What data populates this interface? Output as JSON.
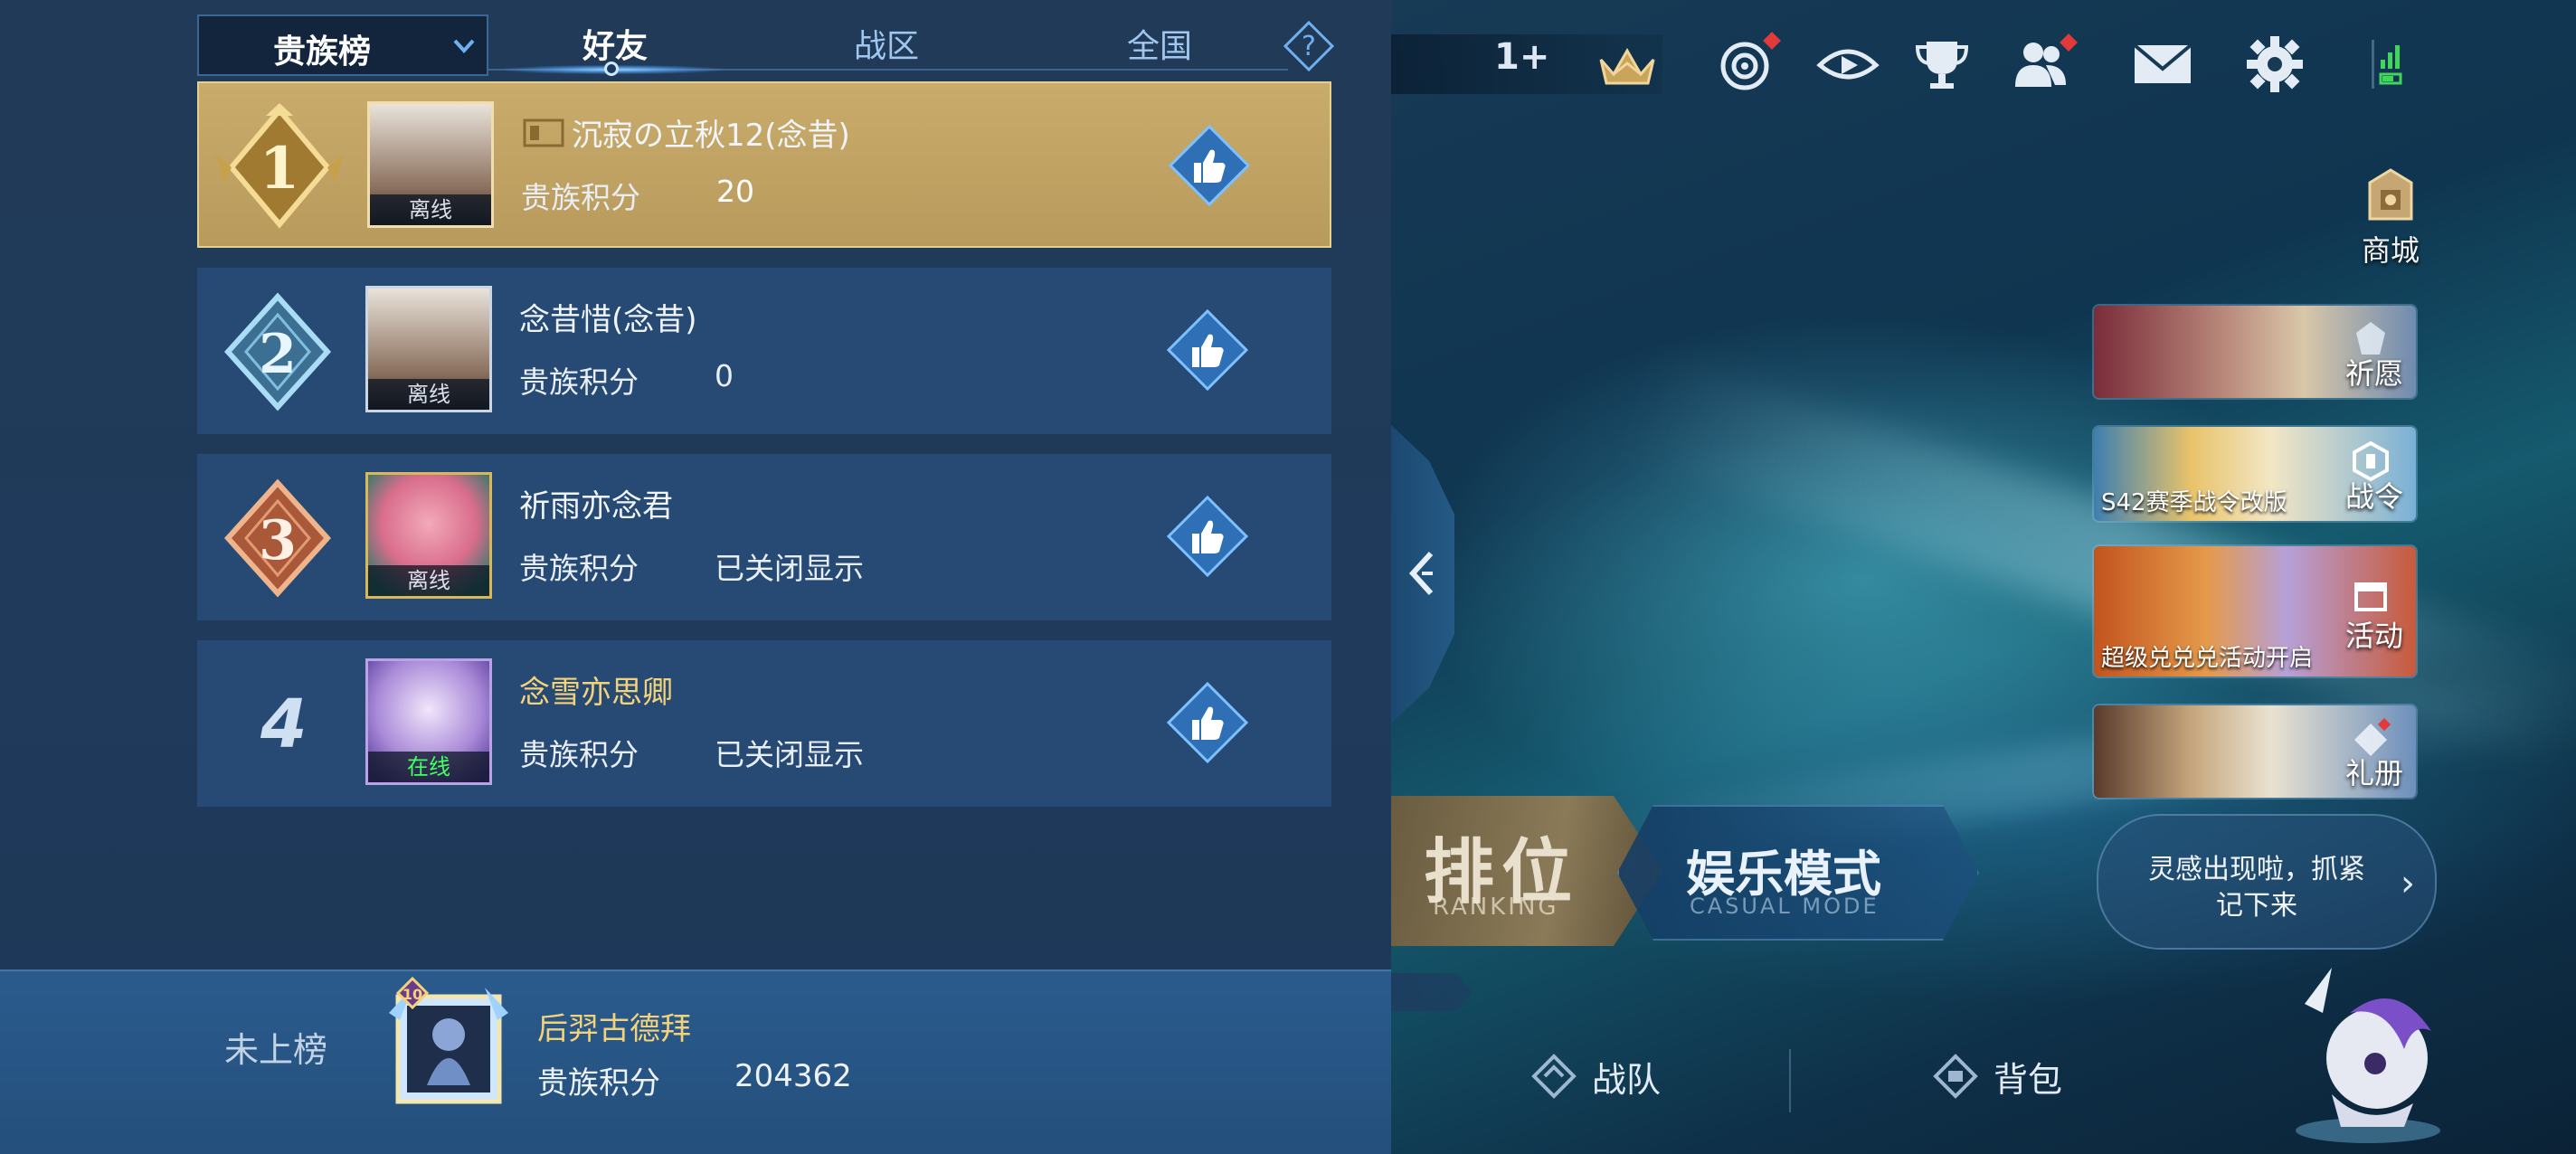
{
  "leaderboard": {
    "dropdown_label": "贵族榜",
    "tabs": [
      "好友",
      "战区",
      "全国"
    ],
    "active_tab": "好友",
    "rows": [
      {
        "rank": "1",
        "name": "沉寂の立秋12(念昔)",
        "score_label": "贵族积分",
        "score": "20",
        "status": "离线"
      },
      {
        "rank": "2",
        "name": "念昔惜(念昔)",
        "score_label": "贵族积分",
        "score": "0",
        "status": "离线"
      },
      {
        "rank": "3",
        "name": "祈雨亦念君",
        "score_label": "贵族积分",
        "score": "已关闭显示",
        "status": "离线"
      },
      {
        "rank": "4",
        "name": "念雪亦思卿",
        "score_label": "贵族积分",
        "score": "已关闭显示",
        "status": "在线"
      }
    ],
    "self": {
      "rank_text": "未上榜",
      "level": "10",
      "name": "后羿古德拜",
      "score_label": "贵族积分",
      "score": "204362"
    }
  },
  "topbar": {
    "plus_one": "1+",
    "icons": [
      "crown-icon",
      "target-icon",
      "eye-icon",
      "trophy-icon",
      "friends-icon",
      "mail-icon",
      "settings-icon",
      "signal-icon"
    ]
  },
  "shop": {
    "label": "商城"
  },
  "banners": [
    {
      "side_label": "祈愿",
      "caption": ""
    },
    {
      "side_label": "战令",
      "caption": "S42赛季战令改版"
    },
    {
      "side_label": "活动",
      "caption": "超级兑兑兑活动开启"
    },
    {
      "side_label": "礼册",
      "caption": ""
    }
  ],
  "modes": {
    "rank_title": "排位",
    "rank_sub": "RANKING",
    "casual_title": "娱乐模式",
    "casual_sub": "CASUAL MODE"
  },
  "inspire": {
    "text": "灵感出现啦，抓紧记下来"
  },
  "bottom_nav": [
    {
      "label": "战队"
    },
    {
      "label": "背包"
    }
  ],
  "colors": {
    "gold_row": "#c9ac6c",
    "row_bg": "#264a74",
    "online_green": "#43ff63",
    "name_yellow": "#f3d27a"
  }
}
